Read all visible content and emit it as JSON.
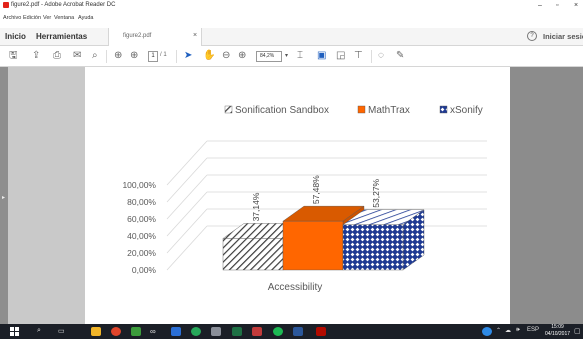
{
  "window": {
    "title": "figure2.pdf - Adobe Acrobat Reader DC",
    "minimize_icon": "minimize-icon",
    "maximize_icon": "maximize-icon",
    "close_icon": "close-icon"
  },
  "menu": {
    "items": [
      "Archivo",
      "Edición",
      "Ver",
      "Ventana",
      "Ayuda"
    ]
  },
  "tabs": {
    "home": "Inicio",
    "tools": "Herramientas",
    "document": "figure2.pdf",
    "document_close": "×",
    "help": "?",
    "signin": "Iniciar sesión"
  },
  "toolbar": {
    "page_current": "1",
    "page_total": "/ 1",
    "zoom": "84,2%",
    "zoom_arrow": "▾"
  },
  "chart_data": {
    "type": "bar",
    "title": "",
    "categories": [
      "Accessibility"
    ],
    "xlabel": "",
    "ylabel": "",
    "ylim": [
      0,
      100
    ],
    "yticks": [
      "0,00%",
      "20,00%",
      "40,00%",
      "60,00%",
      "80,00%",
      "100,00%"
    ],
    "series": [
      {
        "name": "Sonification Sandbox",
        "values": [
          37.14
        ],
        "label": "37,14%",
        "pattern": "diagonal-stripes",
        "color": "#404040"
      },
      {
        "name": "MathTrax",
        "values": [
          57.48
        ],
        "label": "57,48%",
        "pattern": "solid",
        "color": "#ff6600"
      },
      {
        "name": "xSonify",
        "values": [
          53.27
        ],
        "label": "53,27%",
        "pattern": "diamond",
        "color": "#1f3a93"
      }
    ],
    "grid": true,
    "legend_position": "top"
  },
  "taskbar": {
    "lang": "ESP",
    "time": "15:09",
    "date": "04/10/2017"
  }
}
